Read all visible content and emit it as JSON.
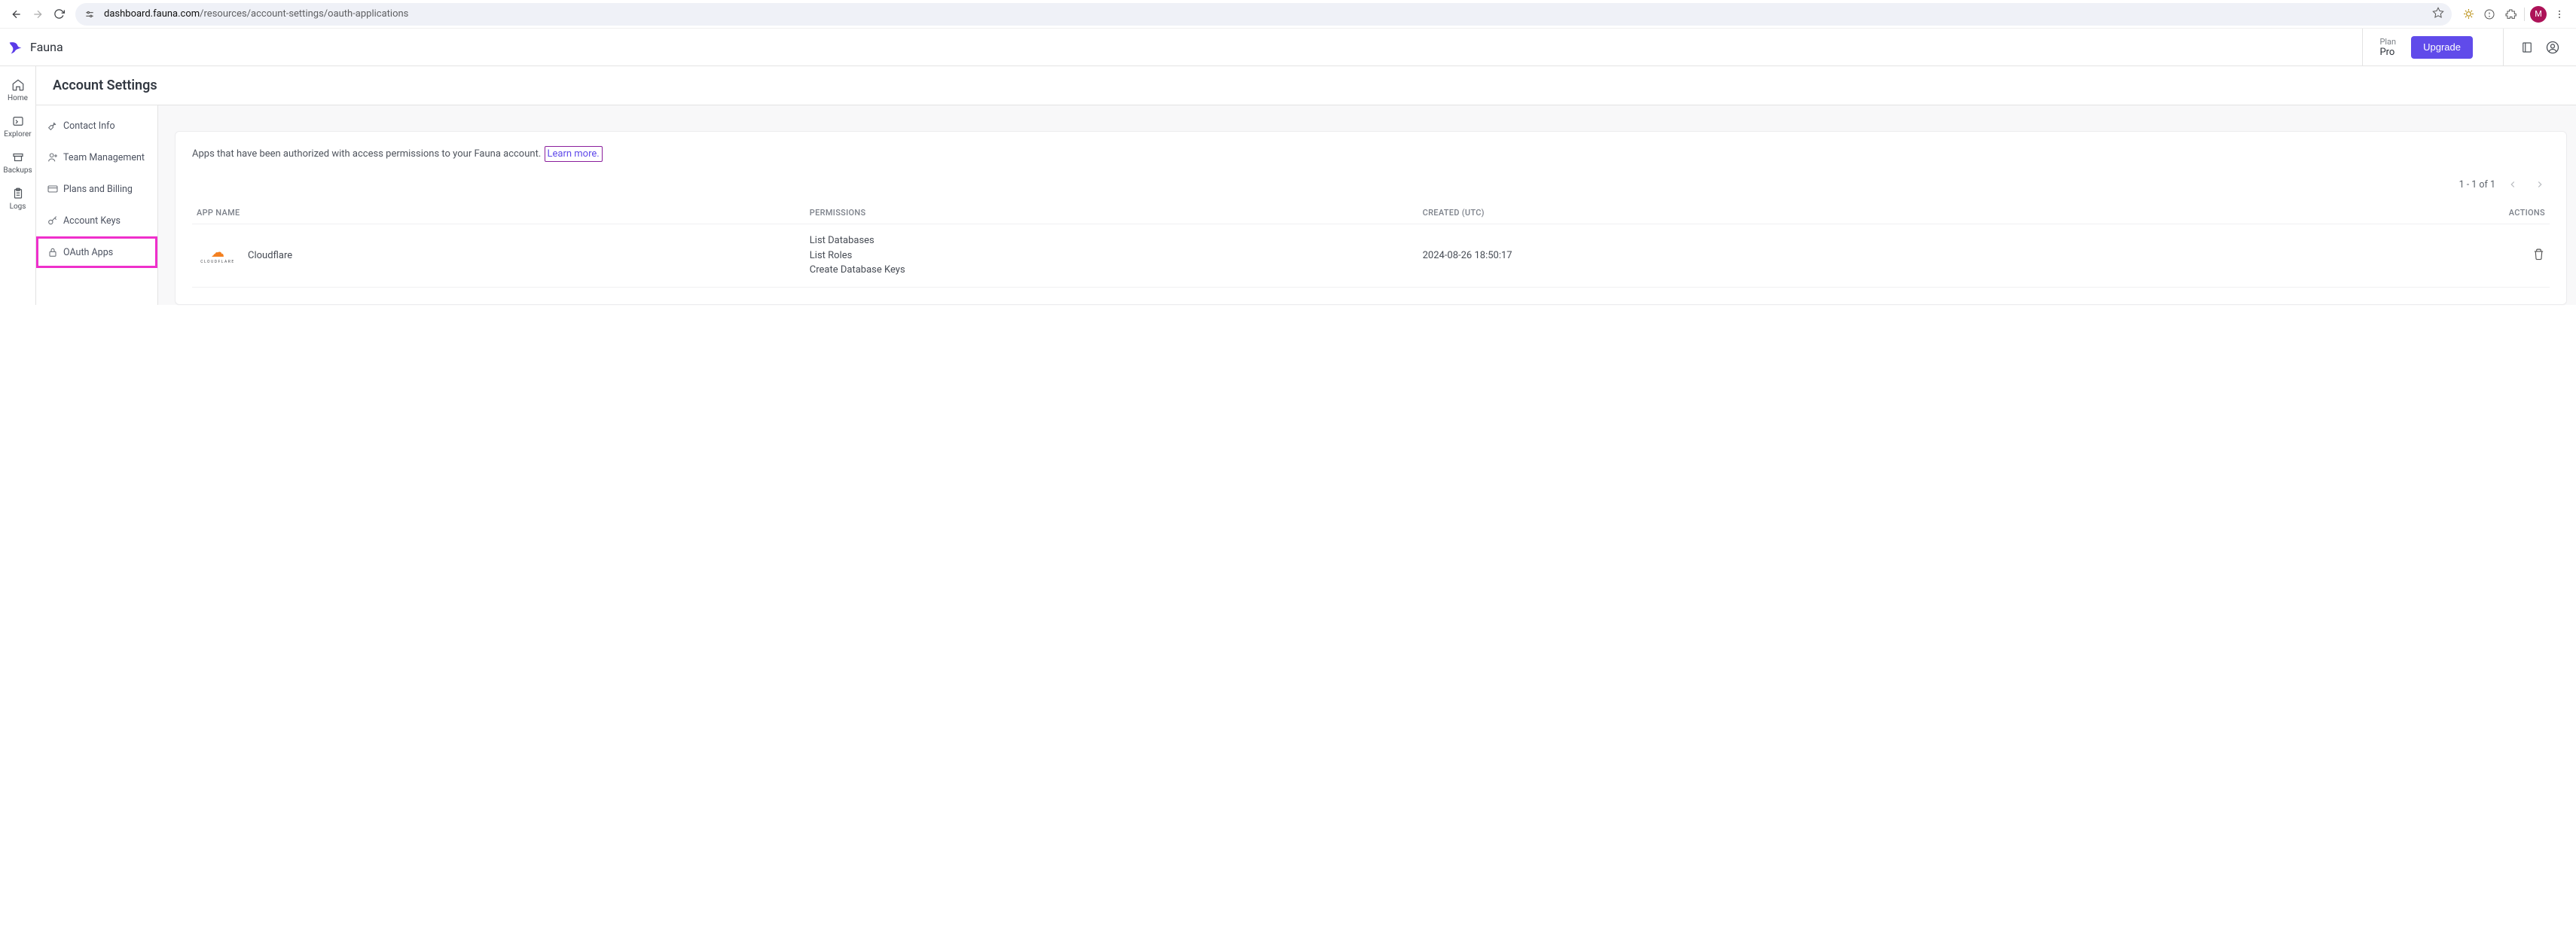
{
  "browser": {
    "url_host": "dashboard.fauna.com",
    "url_path": "/resources/account-settings/oauth-applications",
    "avatar_initial": "M"
  },
  "header": {
    "brand": "Fauna",
    "plan_label": "Plan",
    "plan_value": "Pro",
    "upgrade_label": "Upgrade"
  },
  "rail": {
    "items": [
      {
        "label": "Home"
      },
      {
        "label": "Explorer"
      },
      {
        "label": "Backups"
      },
      {
        "label": "Logs"
      }
    ]
  },
  "page": {
    "title": "Account Settings"
  },
  "subnav": {
    "items": [
      {
        "label": "Contact Info"
      },
      {
        "label": "Team Management"
      },
      {
        "label": "Plans and Billing"
      },
      {
        "label": "Account Keys"
      },
      {
        "label": "OAuth Apps"
      }
    ]
  },
  "panel": {
    "description": "Apps that have been authorized with access permissions to your Fauna account.",
    "learn_more": "Learn more.",
    "page_range": "1 - 1 of 1",
    "columns": {
      "app": "APP NAME",
      "permissions": "PERMISSIONS",
      "created": "CREATED (UTC)",
      "actions": "ACTIONS"
    },
    "rows": [
      {
        "vendor": "CLOUDFLARE",
        "name": "Cloudflare",
        "permissions": [
          "List Databases",
          "List Roles",
          "Create Database Keys"
        ],
        "created": "2024-08-26 18:50:17"
      }
    ]
  }
}
